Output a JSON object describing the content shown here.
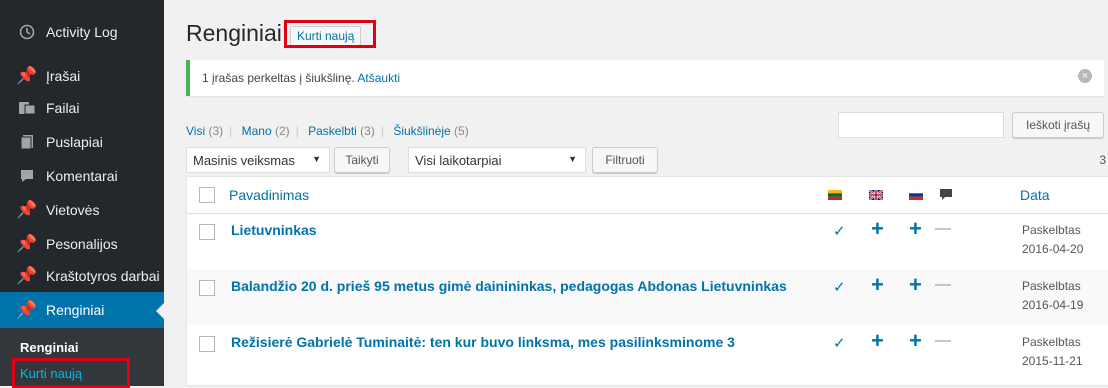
{
  "sidebar": {
    "items": [
      {
        "label": "Activity Log",
        "icon": "clock-icon"
      },
      {
        "label": "Įrašai",
        "icon": "pin-icon"
      },
      {
        "label": "Failai",
        "icon": "media-icon"
      },
      {
        "label": "Puslapiai",
        "icon": "page-icon"
      },
      {
        "label": "Komentarai",
        "icon": "comment-icon"
      },
      {
        "label": "Vietovės",
        "icon": "pin-icon"
      },
      {
        "label": "Pesonalijos",
        "icon": "pin-icon"
      },
      {
        "label": "Kraštotyros darbai",
        "icon": "pin-icon"
      },
      {
        "label": "Renginiai",
        "icon": "pin-icon"
      }
    ],
    "submenu": {
      "title": "Renginiai",
      "add_new": "Kurti naują"
    }
  },
  "main": {
    "title": "Renginiai",
    "add_new": "Kurti naują",
    "notice": {
      "message": "1 įrašas perkeltas į šiukšlinę.",
      "undo": "Atšaukti"
    },
    "filters": [
      {
        "label": "Visi",
        "count": "(3)"
      },
      {
        "label": "Mano",
        "count": "(2)"
      },
      {
        "label": "Paskelbti",
        "count": "(3)"
      },
      {
        "label": "Šiukšlinėje",
        "count": "(5)"
      }
    ],
    "search_button": "Ieškoti įrašų",
    "bulk_select": "Masinis veiksmas",
    "apply_button": "Taikyti",
    "date_select": "Visi laikotarpiai",
    "filter_button": "Filtruoti",
    "item_count": "3",
    "table": {
      "col_title": "Pavadinimas",
      "col_date": "Data",
      "flags": [
        "lt-flag-icon",
        "gb-flag-icon",
        "ru-flag-icon",
        "comment-icon"
      ],
      "rows": [
        {
          "title": "Lietuvninkas",
          "status": "Paskelbtas",
          "date": "2016-04-20",
          "marks": [
            "✓",
            "+",
            "+",
            "—"
          ]
        },
        {
          "title": "Balandžio 20 d. prieš 95 metus gimė dainininkas, pedagogas Abdonas Lietuvninkas",
          "status": "Paskelbtas",
          "date": "2016-04-19",
          "marks": [
            "✓",
            "+",
            "+",
            "—"
          ]
        },
        {
          "title": "Režisierė Gabrielė Tuminaitė: ten kur buvo linksma, mes pasilinksminome 3",
          "status": "Paskelbtas",
          "date": "2015-11-21",
          "marks": [
            "✓",
            "+",
            "+",
            "—"
          ]
        }
      ]
    }
  },
  "colors": {
    "accent": "#0073aa",
    "sidebar": "#23282d",
    "highlight": "#e00012",
    "notice": "#46b450"
  }
}
